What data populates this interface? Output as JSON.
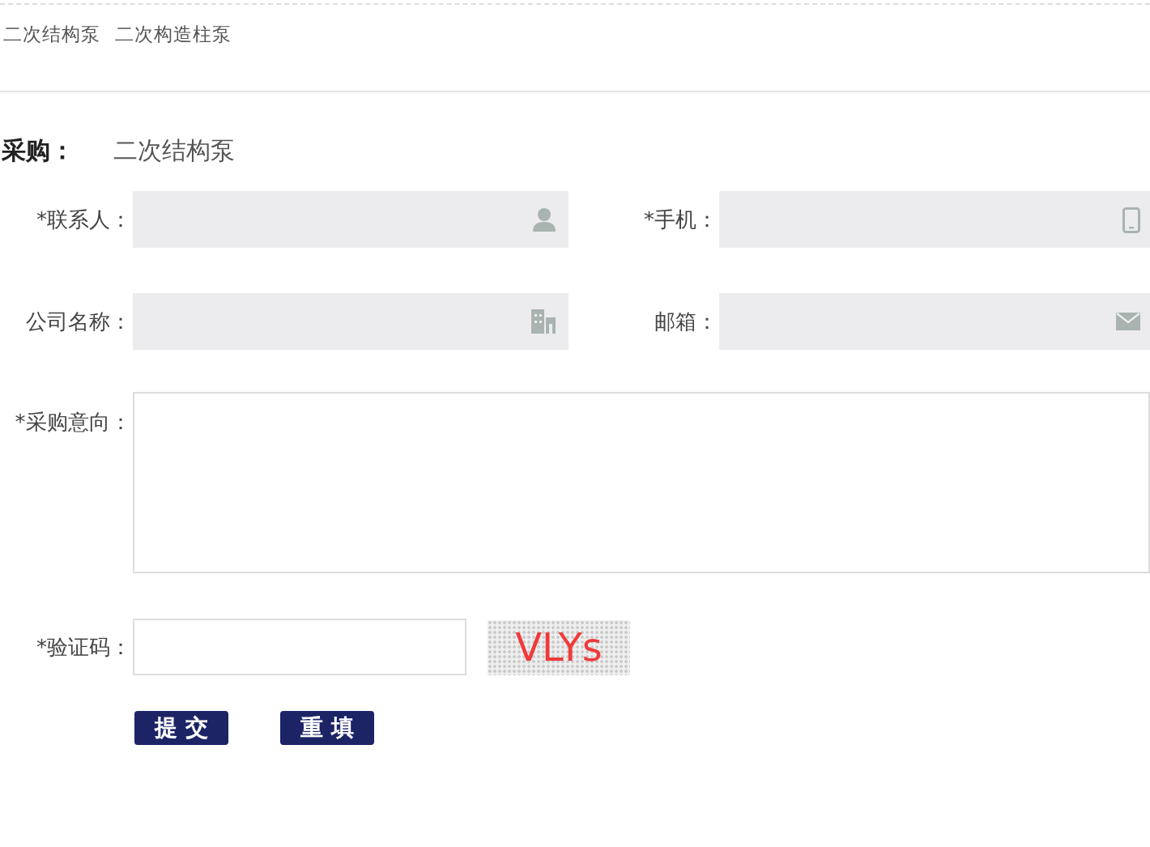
{
  "tags": [
    "二次结构泵",
    "二次构造柱泵"
  ],
  "purchase": {
    "label": "采购：",
    "product": "二次结构泵"
  },
  "fields": [
    {
      "label": "*联系人：",
      "kind": "person"
    },
    {
      "label": "*手机：",
      "kind": "phone"
    },
    {
      "label": "公司名称：",
      "kind": "company"
    },
    {
      "label": "邮箱：",
      "kind": "mail"
    }
  ],
  "message": {
    "label": "*采购意向："
  },
  "captcha": {
    "label": "*验证码：",
    "code": "VLYs"
  },
  "buttons": [
    "提 交",
    "重 填"
  ]
}
